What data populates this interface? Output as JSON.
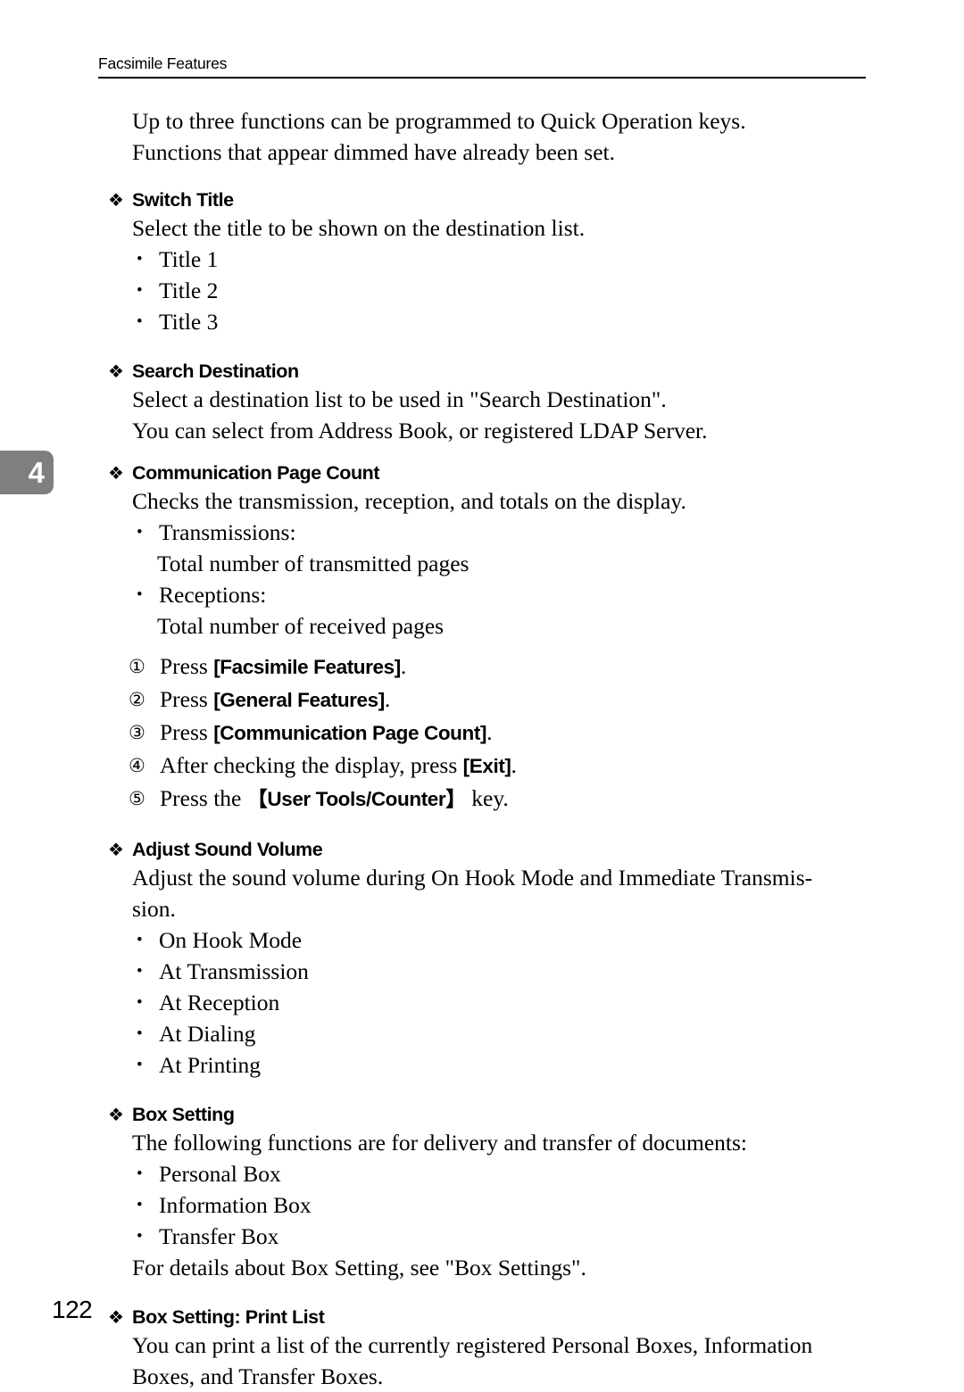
{
  "header": {
    "running_head": "Facsimile Features"
  },
  "chapter_tab": {
    "number": "4",
    "background_color": "#7f7f7f",
    "text_color": "#ffffff"
  },
  "intro": {
    "line1": "Up to three functions can be programmed to Quick Operation keys.",
    "line2": "Functions that appear dimmed have already been set."
  },
  "sections": [
    {
      "bullet_glyph": "❖",
      "title": "Switch Title",
      "body": "Select the title to be shown on the destination list.",
      "items": [
        "Title 1",
        "Title 2",
        "Title 3"
      ]
    },
    {
      "bullet_glyph": "❖",
      "title": "Search Destination",
      "body_line1": "Select a destination list to be used in \"Search Destination\".",
      "body_line2": "You can select from Address Book, or registered LDAP Server."
    },
    {
      "bullet_glyph": "❖",
      "title": "Communication Page Count",
      "body": "Checks the transmission, reception, and totals on the display.",
      "items": [
        {
          "label": "Transmissions:",
          "detail": "Total number of transmitted pages"
        },
        {
          "label": "Receptions:",
          "detail": "Total number of received pages"
        }
      ],
      "steps": [
        {
          "marker": "①",
          "pre": "Press ",
          "key": "[Facsimile Features]",
          "post": "."
        },
        {
          "marker": "②",
          "pre": "Press ",
          "key": "[General Features]",
          "post": "."
        },
        {
          "marker": "③",
          "pre": "Press ",
          "key": "[Communication Page Count]",
          "post": "."
        },
        {
          "marker": "④",
          "pre": "After checking the display, press ",
          "key": "[Exit]",
          "post": "."
        },
        {
          "marker": "⑤",
          "pre": "Press the ",
          "key_open": "【",
          "key_label": "User Tools/Counter",
          "key_close": "】",
          "post": " key."
        }
      ]
    },
    {
      "bullet_glyph": "❖",
      "title": "Adjust Sound Volume",
      "body_line1": "Adjust the sound volume during On Hook Mode and Immediate Transmis-",
      "body_line2": "sion.",
      "items": [
        "On Hook Mode",
        "At Transmission",
        "At Reception",
        "At Dialing",
        "At Printing"
      ]
    },
    {
      "bullet_glyph": "❖",
      "title": "Box Setting",
      "body": "The following functions are for delivery and transfer of documents:",
      "items": [
        "Personal Box",
        "Information Box",
        "Transfer Box"
      ],
      "footnote": "For details about Box Setting, see \"Box Settings\"."
    },
    {
      "bullet_glyph": "❖",
      "title": "Box Setting: Print List",
      "body_line1": "You can print a list of the currently registered Personal Boxes, Information",
      "body_line2": "Boxes, and Transfer Boxes."
    }
  ],
  "footer": {
    "page_number": "122"
  }
}
